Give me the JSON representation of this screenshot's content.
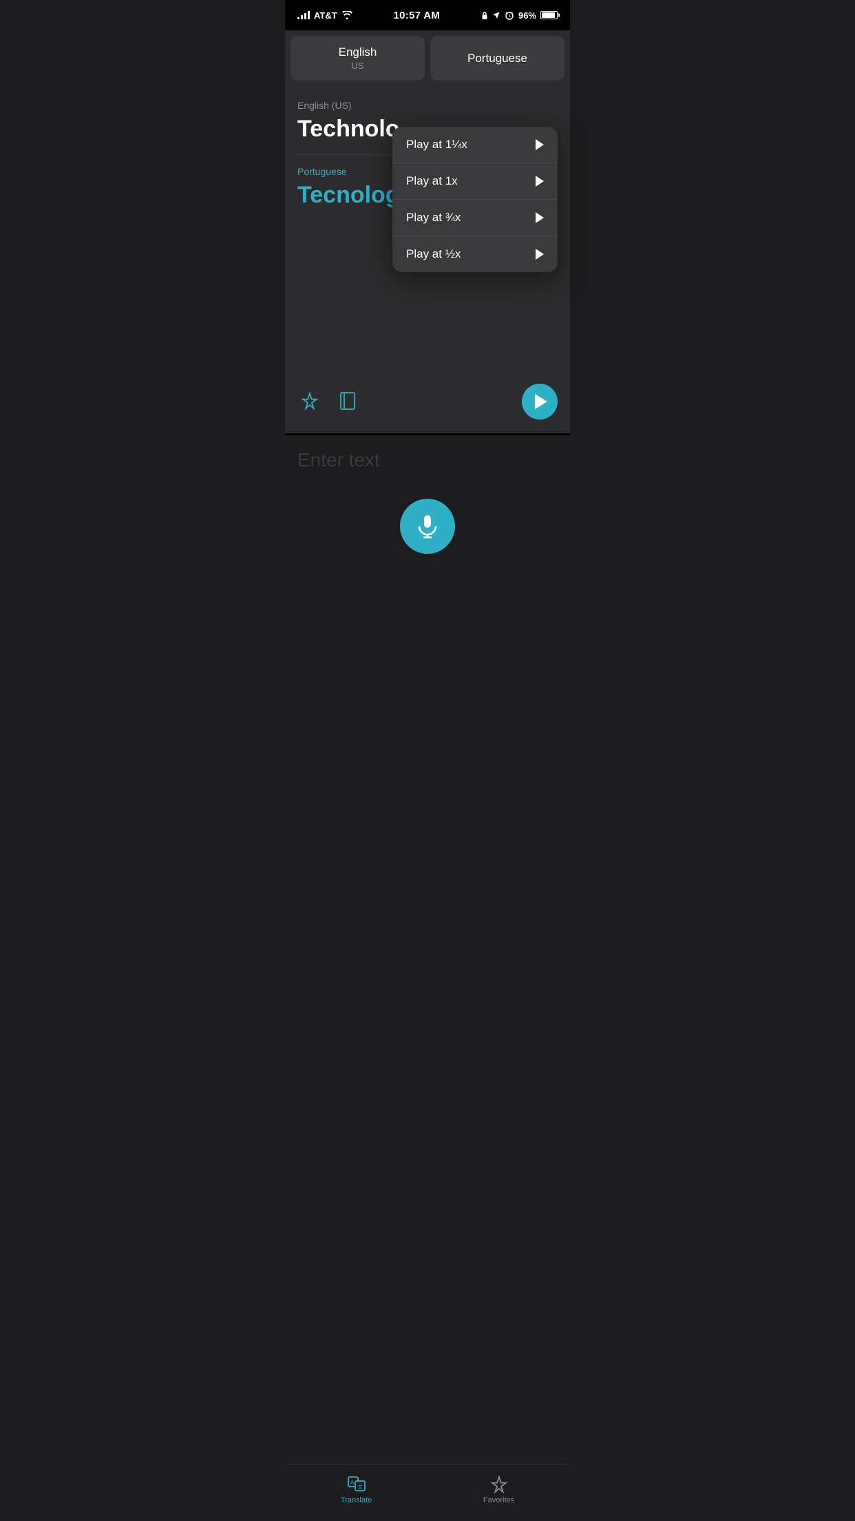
{
  "statusBar": {
    "carrier": "AT&T",
    "time": "10:57 AM",
    "batteryPercent": "96%"
  },
  "languageSelector": {
    "sourceLanguage": "English",
    "sourceRegion": "US",
    "targetLanguage": "Portuguese"
  },
  "translationCard": {
    "sourceLabel": "English (US)",
    "sourceText": "Technolo",
    "targetLabel": "Portuguese",
    "targetText": "Tecnolog"
  },
  "speedMenu": {
    "items": [
      {
        "label": "Play at 1¼x"
      },
      {
        "label": "Play at 1x"
      },
      {
        "label": "Play at ¾x"
      },
      {
        "label": "Play at ½x"
      }
    ]
  },
  "inputArea": {
    "placeholder": "Enter text"
  },
  "bottomNav": {
    "translateLabel": "Translate",
    "favoritesLabel": "Favorites"
  }
}
